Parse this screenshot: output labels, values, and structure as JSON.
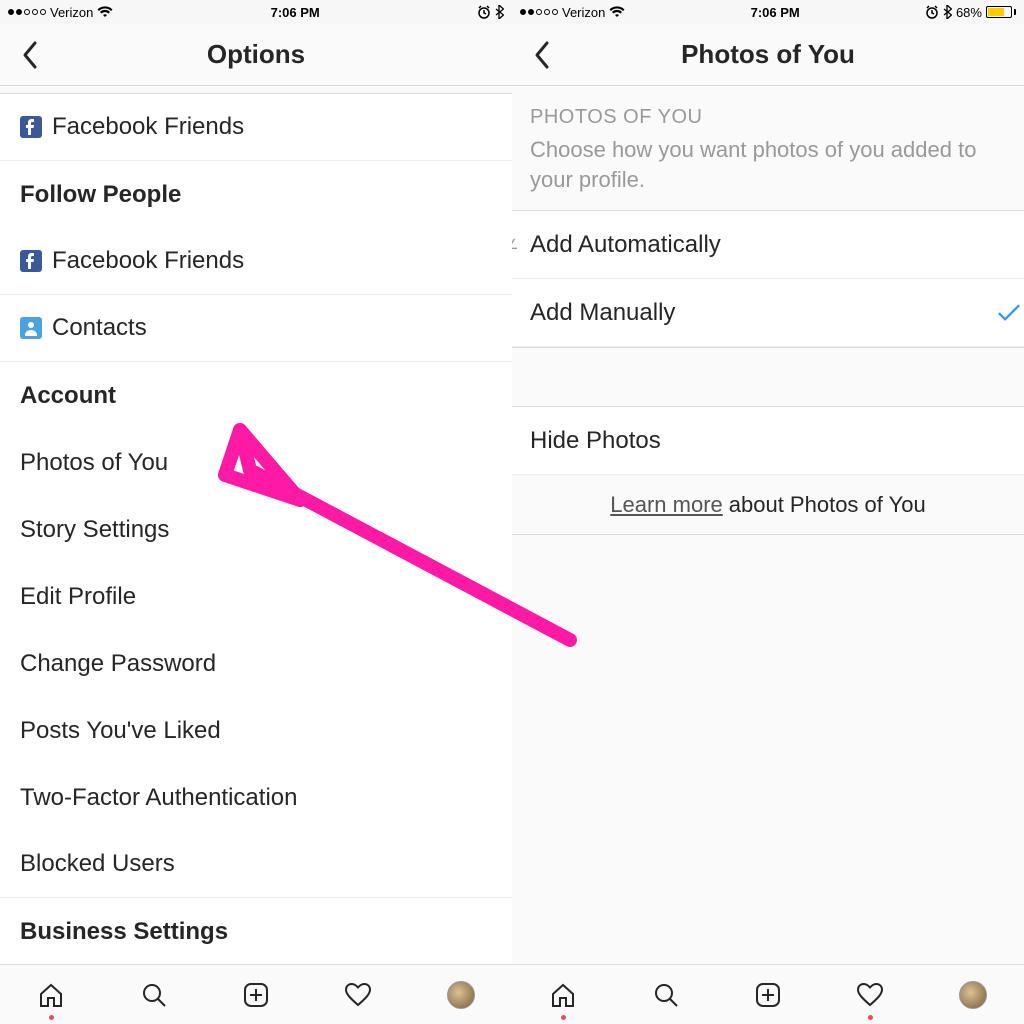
{
  "left": {
    "status": {
      "carrier": "Verizon",
      "time": "7:06 PM",
      "signal_filled": 2,
      "signal_total": 5,
      "wifi": true,
      "alarm": true,
      "bluetooth": true,
      "battery_percent": null
    },
    "header": {
      "title": "Options"
    },
    "items": [
      {
        "type": "row",
        "label": "Facebook Friends",
        "icon": "facebook-icon"
      },
      {
        "type": "section",
        "label": "Follow People"
      },
      {
        "type": "row",
        "label": "Facebook Friends",
        "icon": "facebook-icon"
      },
      {
        "type": "row",
        "label": "Contacts",
        "icon": "contacts-icon"
      },
      {
        "type": "section",
        "label": "Account"
      },
      {
        "type": "row",
        "label": "Photos of You"
      },
      {
        "type": "row",
        "label": "Story Settings"
      },
      {
        "type": "row",
        "label": "Edit Profile"
      },
      {
        "type": "row",
        "label": "Change Password"
      },
      {
        "type": "row",
        "label": "Posts You've Liked"
      },
      {
        "type": "row",
        "label": "Two-Factor Authentication"
      },
      {
        "type": "row",
        "label": "Blocked Users"
      },
      {
        "type": "section",
        "label": "Business Settings"
      }
    ]
  },
  "right": {
    "status": {
      "carrier": "Verizon",
      "time": "7:06 PM",
      "signal_filled": 2,
      "signal_total": 5,
      "wifi": true,
      "alarm": true,
      "bluetooth": true,
      "battery_percent": "68%"
    },
    "header": {
      "title": "Photos of You"
    },
    "subheader": "PHOTOS OF YOU",
    "description": "Choose how you want photos of you added to your profile.",
    "options": {
      "auto": "Add Automatically",
      "manual": "Add Manually",
      "selected": "manual"
    },
    "hide_label": "Hide Photos",
    "learn_more_link": "Learn more",
    "learn_more_rest": "about Photos of You"
  },
  "tabs": {
    "home_dot": true,
    "activity_dot_left": false,
    "activity_dot_right": true
  },
  "annotation": {
    "color": "#ff1aa6"
  }
}
